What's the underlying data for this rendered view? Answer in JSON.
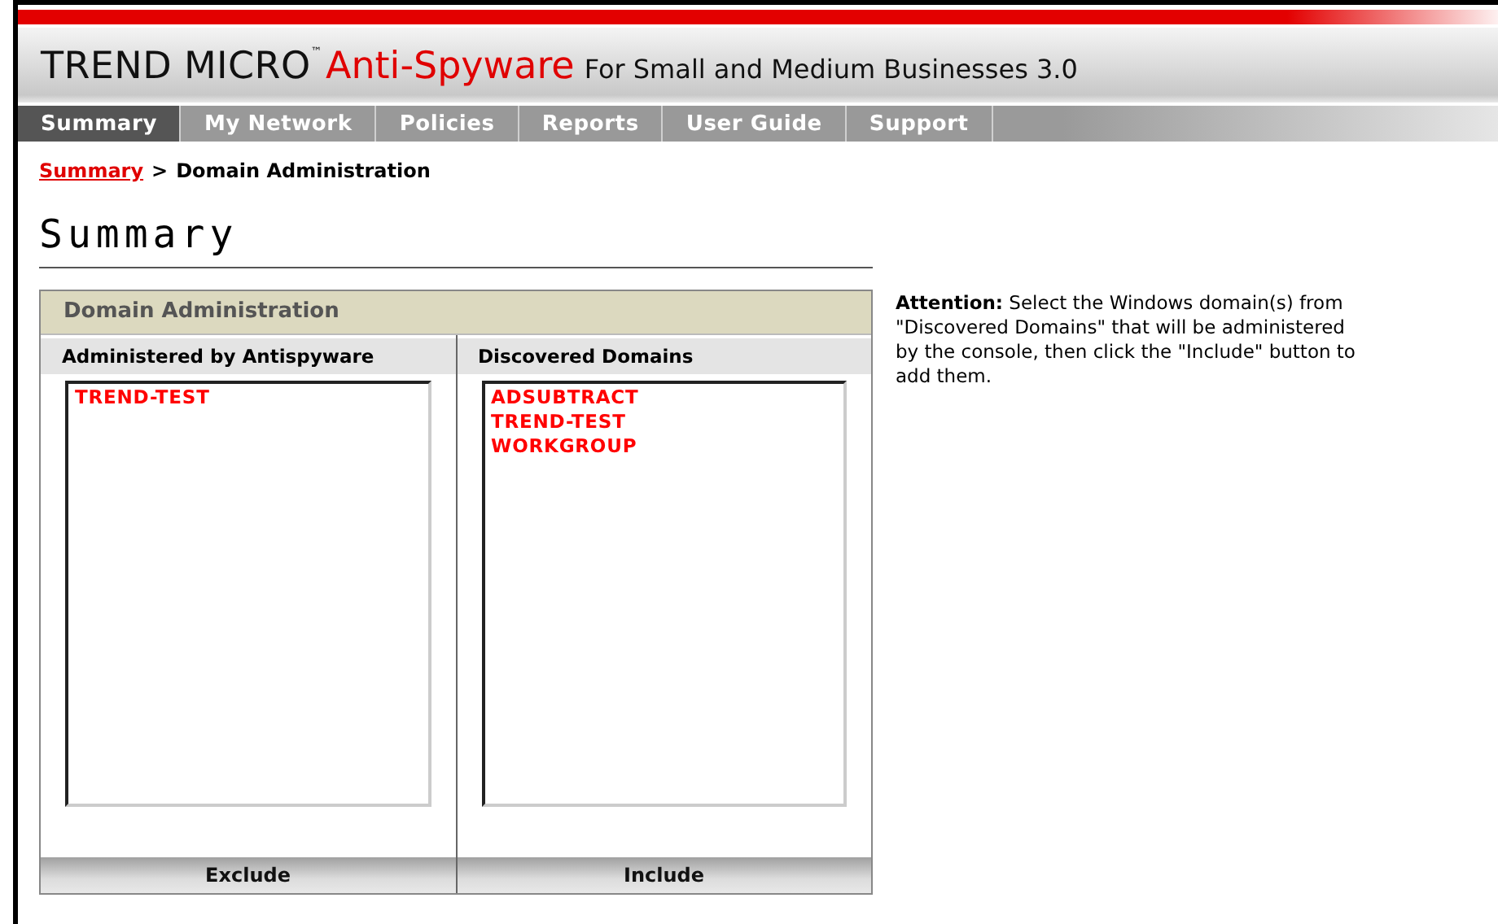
{
  "header": {
    "brand": "TREND MICRO$^{™}$",
    "product": "Anti-Spyware",
    "subtitle": "For Small and Medium Businesses 3.0"
  },
  "tabs": [
    {
      "label": "Summary",
      "selected": true
    },
    {
      "label": "My Network",
      "selected": false
    },
    {
      "label": "Policies",
      "selected": false
    },
    {
      "label": "Reports",
      "selected": false
    },
    {
      "label": "User Guide",
      "selected": false
    },
    {
      "label": "Support",
      "selected": false
    }
  ],
  "breadcrumb": {
    "link": "Summary",
    "separator": ">",
    "current": "Domain Administration"
  },
  "page_title": "Summary",
  "panel": {
    "title": "Domain Administration",
    "columns": [
      {
        "heading": "Administered by Antispyware",
        "items": [
          "TREND-TEST"
        ],
        "button": "Exclude"
      },
      {
        "heading": "Discovered Domains",
        "items": [
          "ADSUBTRACT",
          "TREND-TEST",
          "WORKGROUP"
        ],
        "button": "Include"
      }
    ]
  },
  "note": "**Attention:** Select the Windows domain(s) from \"Discovered Domains\" that will be administered by the console, then click the \"Include\" button to add them."
}
